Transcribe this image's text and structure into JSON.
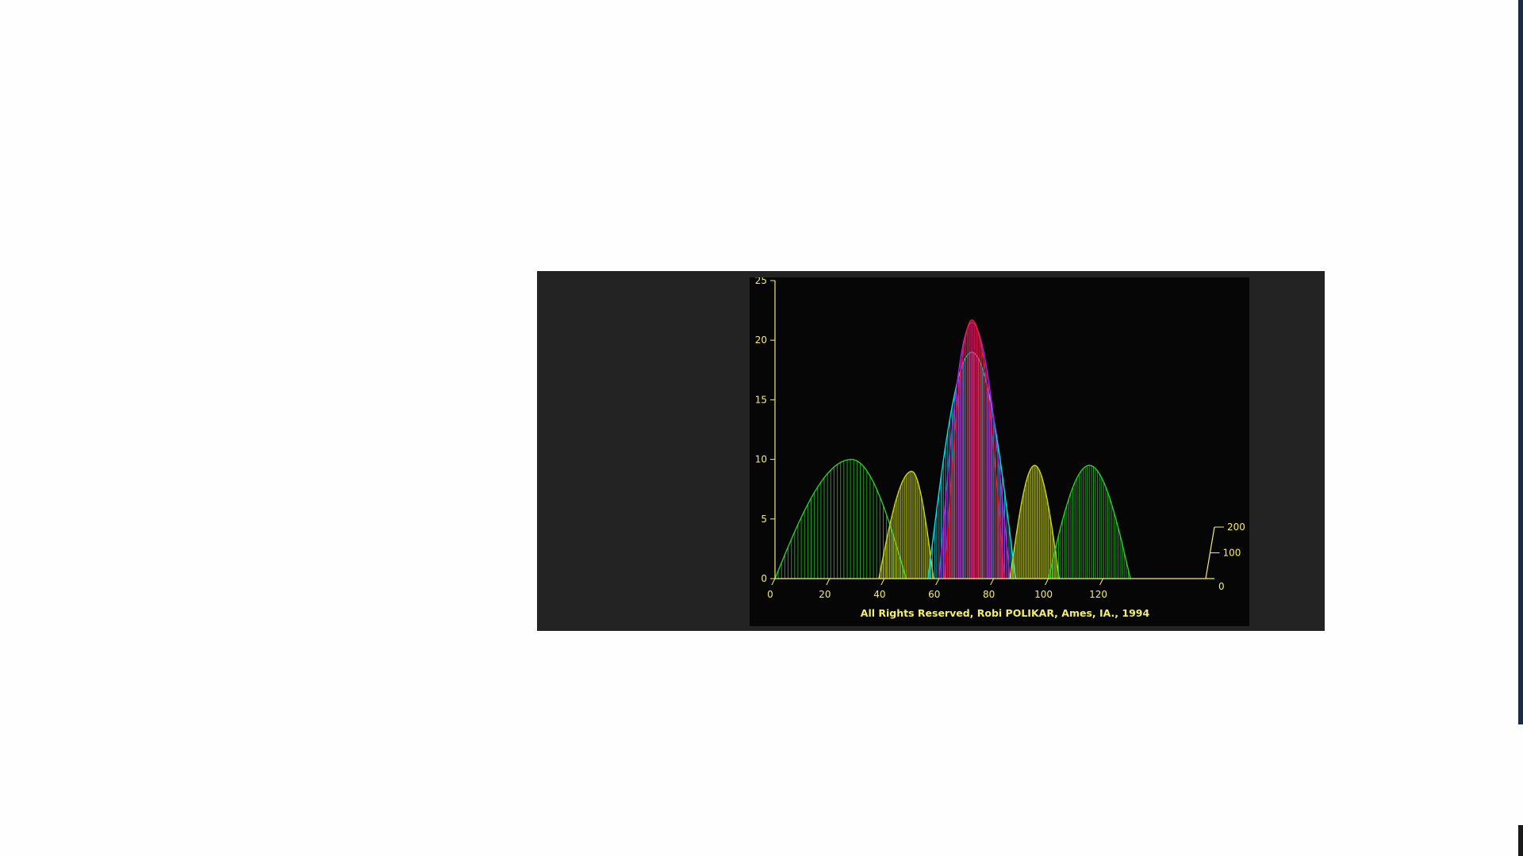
{
  "viewer": {
    "caption": "All Rights Reserved, Robi POLIKAR, Ames, IA., 1994"
  },
  "colors": {
    "axis": "#f2ee66",
    "panel_background": "#060606",
    "viewer_background": "#232323"
  },
  "chart_data": {
    "type": "area",
    "style": "3d waterfall",
    "x_ticks": [
      "0",
      "20",
      "40",
      "60",
      "80",
      "100",
      "120"
    ],
    "y_ticks": [
      "0",
      "5",
      "10",
      "15",
      "20",
      "25"
    ],
    "z_ticks": [
      "0",
      "100",
      "200"
    ],
    "xlim": [
      0,
      130
    ],
    "ylim": [
      0,
      25
    ],
    "zlim": [
      0,
      200
    ],
    "envelopes": [
      {
        "color": "#23d123",
        "x_start": 0,
        "x_end": 48,
        "peak_x": 28,
        "peak": 10
      },
      {
        "color": "#c9d61f",
        "x_start": 38,
        "x_end": 58,
        "peak_x": 50,
        "peak": 9
      },
      {
        "color": "#00e0e8",
        "x_start": 56,
        "x_end": 88,
        "peak_x": 72,
        "peak": 19
      },
      {
        "color": "#b020e0",
        "x_start": 60,
        "x_end": 86,
        "peak_x": 72,
        "peak": 21.5
      },
      {
        "color": "#e01a30",
        "x_start": 62,
        "x_end": 84,
        "peak_x": 72,
        "peak": 21.7
      },
      {
        "color": "#c9d61f",
        "x_start": 86,
        "x_end": 104,
        "peak_x": 95,
        "peak": 9.5
      },
      {
        "color": "#23d123",
        "x_start": 100,
        "x_end": 130,
        "peak_x": 115,
        "peak": 9.5
      }
    ]
  }
}
